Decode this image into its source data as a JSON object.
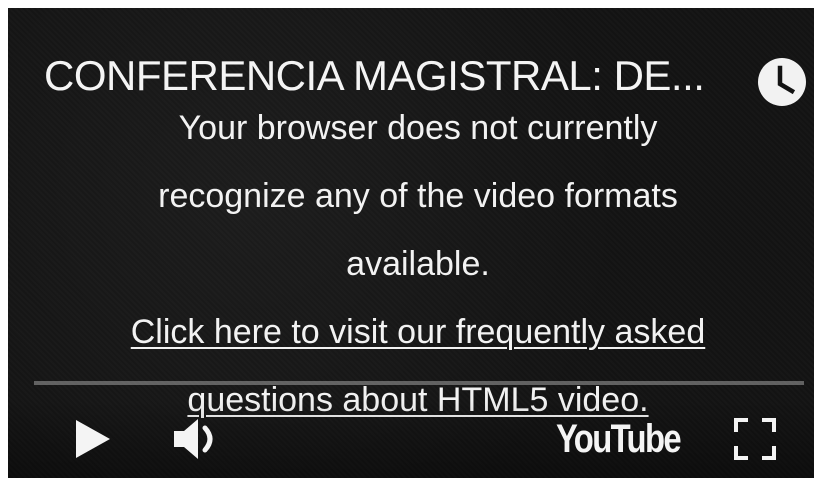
{
  "video": {
    "title": "CONFERENCIA MAGISTRAL: DE...",
    "error_lines": [
      "Your browser does not currently",
      "recognize any of the video formats",
      "available."
    ],
    "faq_link_lines": [
      "Click here to visit our frequently asked",
      "questions about HTML5 video."
    ],
    "progress": 0,
    "brand": "YouTube"
  },
  "icons": {
    "watch_later": "clock-icon",
    "play": "play-icon",
    "volume": "volume-icon",
    "fullscreen": "fullscreen-icon"
  },
  "colors": {
    "background": "#131313",
    "text": "#f2f2f2",
    "progress_track": "#8c8c8c"
  }
}
